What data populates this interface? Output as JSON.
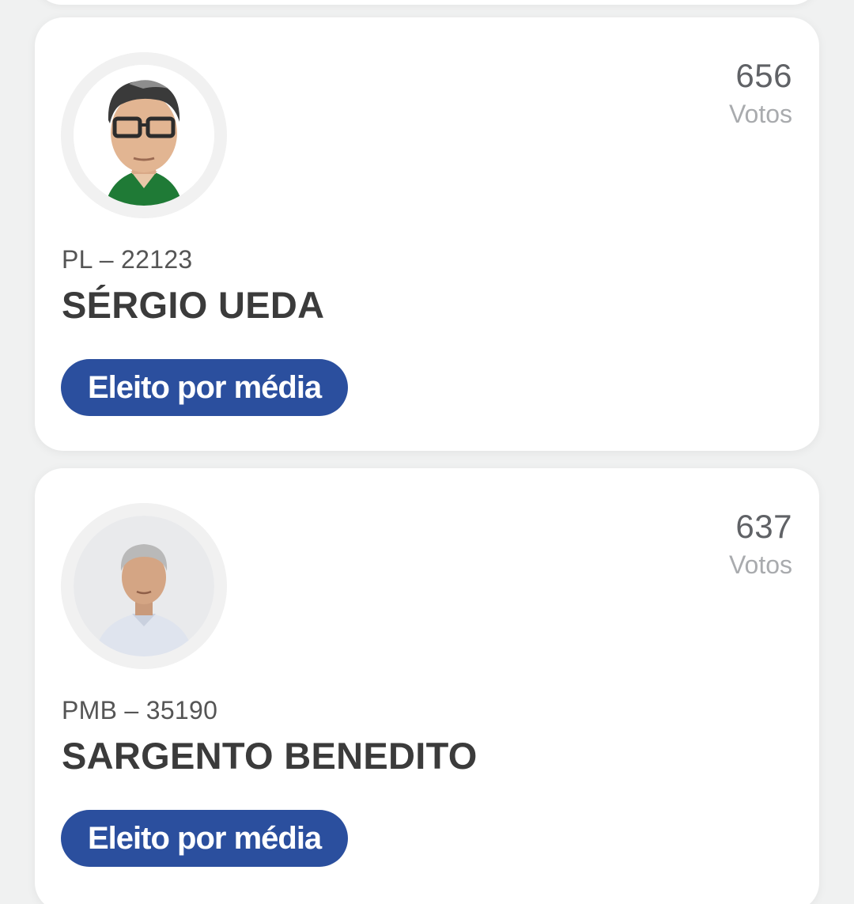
{
  "candidates": [
    {
      "votes": "656",
      "votes_label": "Votos",
      "party": "PL – 22123",
      "name": "SÉRGIO UEDA",
      "status": "Eleito por média",
      "colors": {
        "badge": "#2b4f9e",
        "shirt": "#1f7a36"
      }
    },
    {
      "votes": "637",
      "votes_label": "Votos",
      "party": "PMB – 35190",
      "name": "SARGENTO BENEDITO",
      "status": "Eleito por média",
      "colors": {
        "badge": "#2b4f9e",
        "shirt": "#dfe4ee"
      }
    }
  ]
}
